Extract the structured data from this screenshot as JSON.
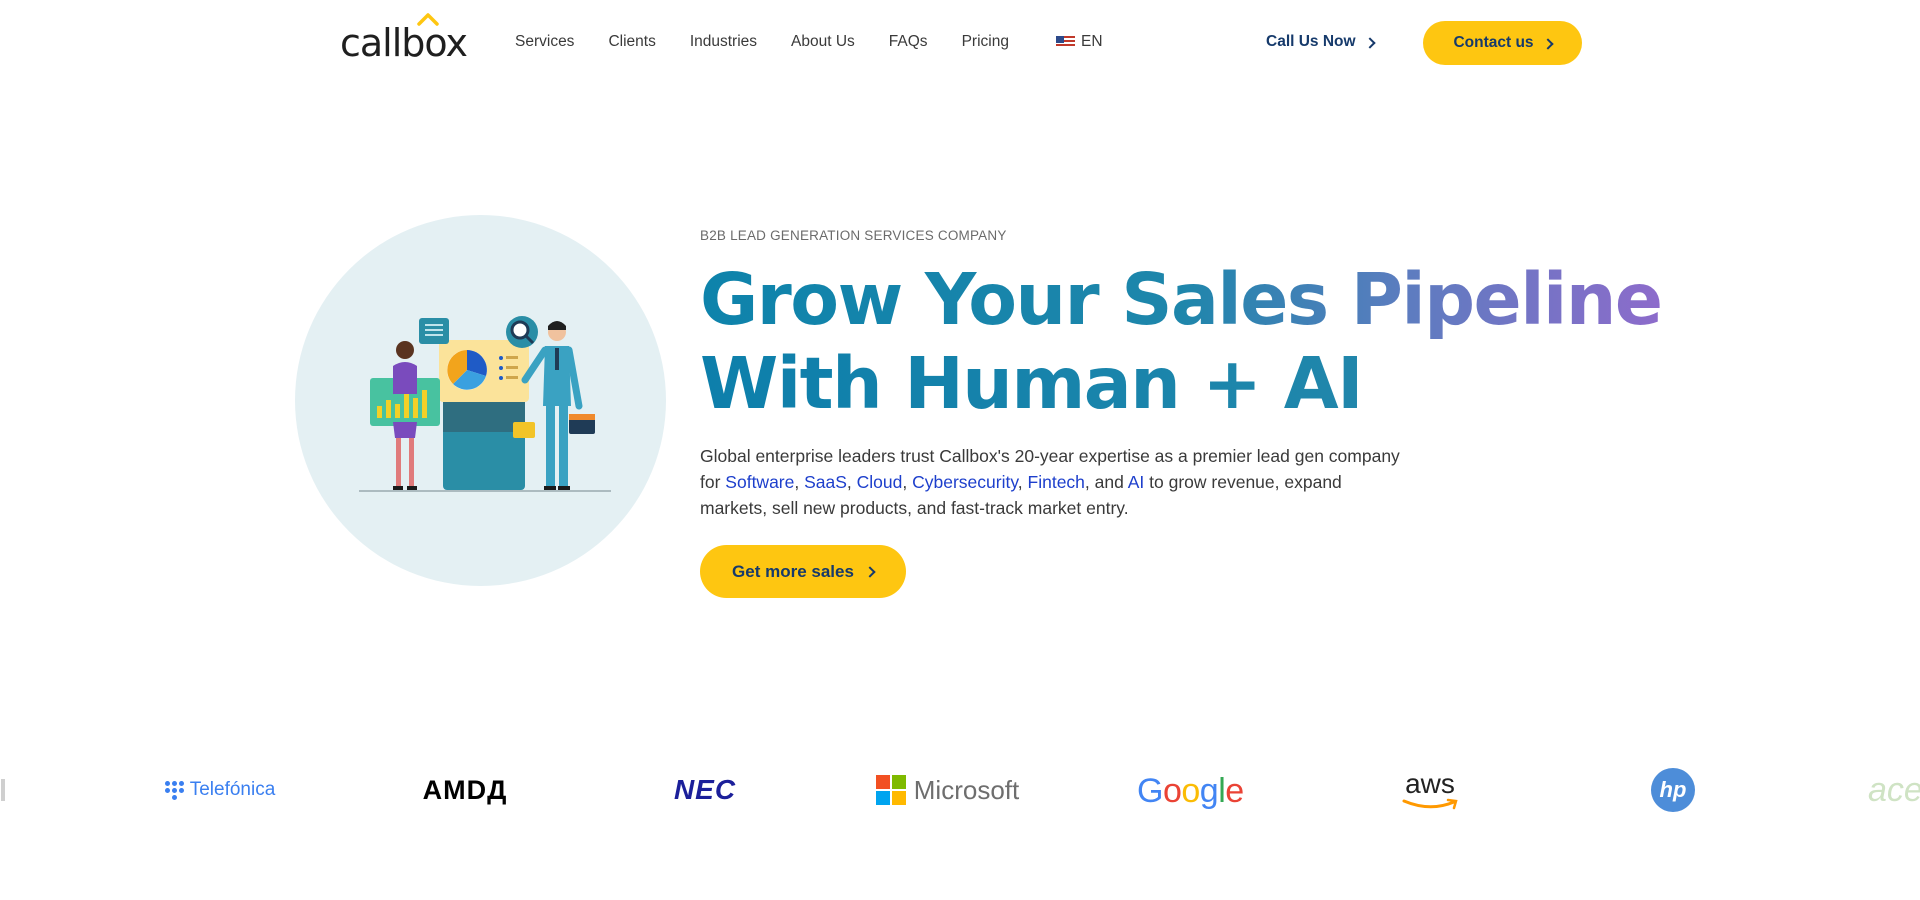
{
  "header": {
    "logo_text": "callbox",
    "nav": [
      "Services",
      "Clients",
      "Industries",
      "About Us",
      "FAQs",
      "Pricing"
    ],
    "language": {
      "label": "EN",
      "icon": "us-flag-icon"
    },
    "call_link": "Call Us Now",
    "contact_button": "Contact us"
  },
  "hero": {
    "eyebrow": "B2B LEAD GENERATION SERVICES COMPANY",
    "headline_line1": "Grow Your Sales Pipeline",
    "headline_line2": "With Human + AI",
    "desc_part1": "Global enterprise leaders trust Callbox's 20-year expertise as a premier lead gen company for ",
    "link_software": "Software",
    "sep1": ", ",
    "link_saas": "SaaS",
    "sep2": ", ",
    "link_cloud": "Cloud",
    "sep3": ", ",
    "link_cyber": "Cybersecurity",
    "sep4": ", ",
    "link_fintech": "Fintech",
    "sep5": ", and ",
    "link_ai": "AI",
    "desc_part2": " to grow revenue, expand markets, sell new products, and fast-track market entry.",
    "cta_button": "Get more sales"
  },
  "client_logos": {
    "telefonica": "Telefónica",
    "amd": "AMDД",
    "nec": "NEC",
    "microsoft": "Microsoft",
    "google": "Google",
    "aws": "aws",
    "hp": "hp",
    "acer": "acer"
  },
  "colors": {
    "accent_yellow": "#fec611",
    "navy": "#163a6b",
    "link_blue": "#1d3fcc",
    "headline_teal": "#0e83ab",
    "headline_purple": "#8d6bcb",
    "circle_bg": "#e4f0f3"
  }
}
